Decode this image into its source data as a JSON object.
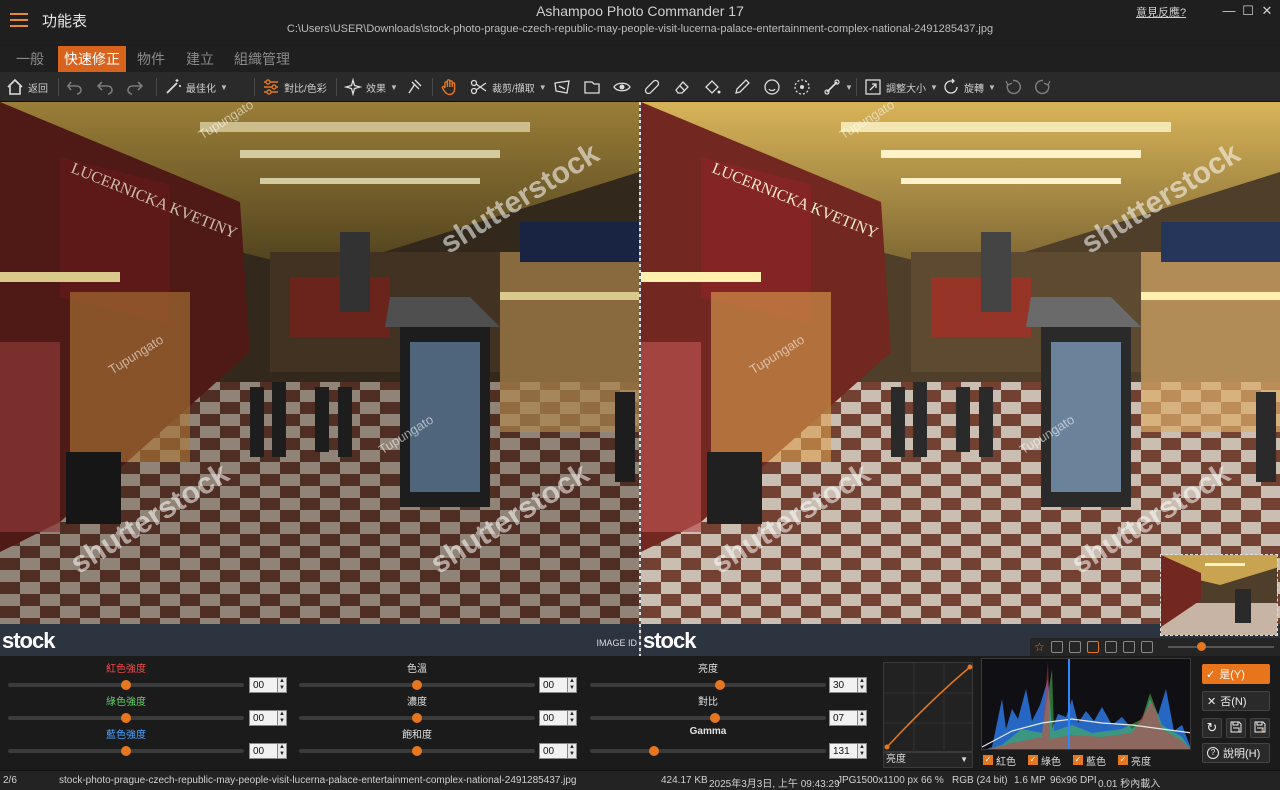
{
  "titlebar": {
    "menu_title": "功能表",
    "app_title": "Ashampoo Photo Commander 17",
    "file_path": "C:\\Users\\USER\\Downloads\\stock-photo-prague-czech-republic-may-people-visit-lucerna-palace-entertainment-complex-national-2491285437.jpg",
    "feedback": "意見反應?"
  },
  "tabs": [
    {
      "label": "一般",
      "active": false
    },
    {
      "label": "快速修正",
      "active": true
    },
    {
      "label": "物件",
      "active": false
    },
    {
      "label": "建立",
      "active": false
    },
    {
      "label": "組織管理",
      "active": false
    }
  ],
  "toolbar": {
    "back": "返回",
    "optimize": "最佳化",
    "contrast_color": "對比/色彩",
    "effects": "效果",
    "crop": "裁剪/擷取",
    "resize": "調整大小",
    "rotate": "旋轉"
  },
  "viewer": {
    "watermark": "shutterstock",
    "watermark_small": "Tupungato",
    "stock_logo": "stock",
    "image_id": "IMAGE ID"
  },
  "adjust": {
    "red": {
      "label": "紅色強度",
      "value": "00"
    },
    "green": {
      "label": "綠色強度",
      "value": "00"
    },
    "blue": {
      "label": "藍色強度",
      "value": "00"
    },
    "temperature": {
      "label": "色溫",
      "value": "00"
    },
    "density": {
      "label": "濃度",
      "value": "00"
    },
    "saturation": {
      "label": "飽和度",
      "value": "00"
    },
    "brightness": {
      "label": "亮度",
      "value": "30"
    },
    "contrast": {
      "label": "對比",
      "value": "07"
    },
    "gamma": {
      "label": "Gamma",
      "value": "131"
    }
  },
  "curve": {
    "channel": "亮度"
  },
  "histogram": {
    "checks": [
      "紅色",
      "綠色",
      "藍色",
      "亮度"
    ],
    "colors": {
      "red": "#e03a3a",
      "green": "#4cc04c",
      "blue": "#2f86ff",
      "luma": "#e8e8e8"
    }
  },
  "actions": {
    "yes": "是(Y)",
    "no": "否(N)",
    "help": "說明(H)"
  },
  "status": {
    "index": "2/6",
    "filename": "stock-photo-prague-czech-republic-may-people-visit-lucerna-palace-entertainment-complex-national-2491285437.jpg",
    "size": "424.17 KB",
    "date": "2025年3月3日, 上午 09:43:29",
    "format": "JPG",
    "dims": "1500x1100 px",
    "zoom": "66 %",
    "color": "RGB (24 bit)",
    "mp": "1.6 MP",
    "dpi": "96x96 DPI",
    "load": "0.01 秒內載入"
  },
  "accent": "#e6771f"
}
